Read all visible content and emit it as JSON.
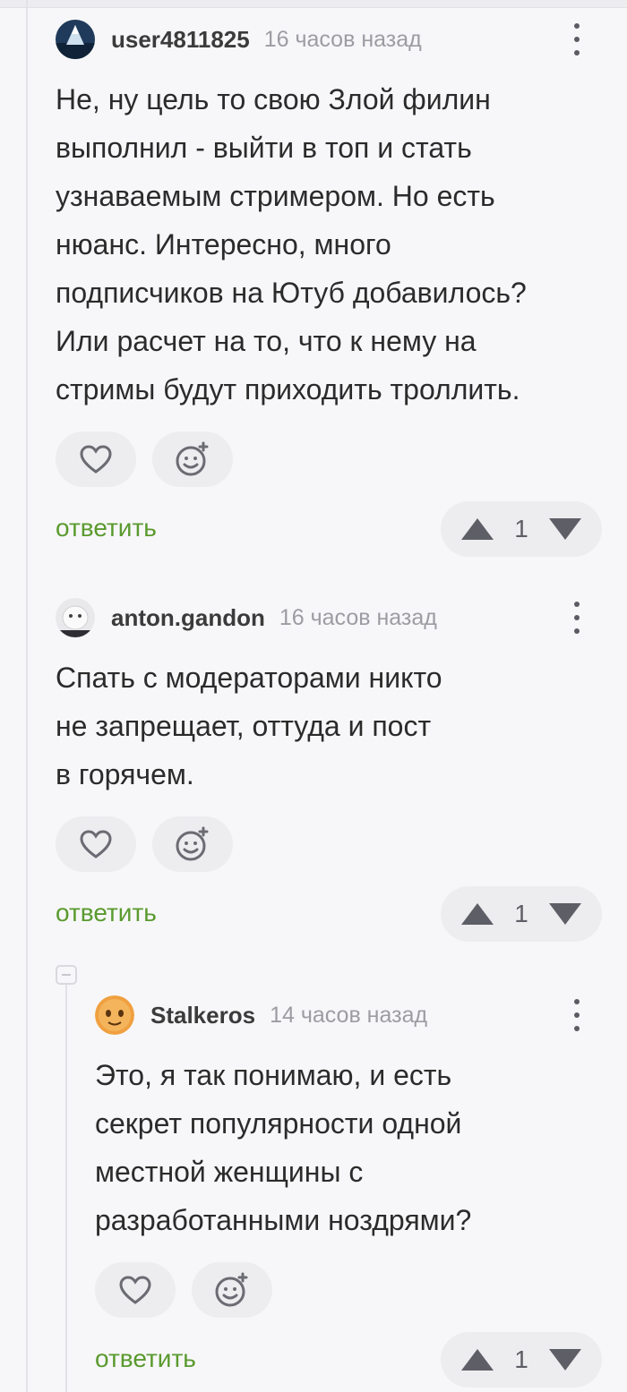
{
  "comments": [
    {
      "username": "user4811825",
      "time": "16 часов назад",
      "text": "Не, ну цель то свою Злой филин\nвыполнил - выйти в топ и стать\nузнаваемым стримером. Но есть\nнюанс. Интересно, много\nподписчиков на Ютуб добавилось?\nИли расчет на то, что к нему на\nстримы будут приходить троллить.",
      "reply_label": "ответить",
      "rating": "1"
    },
    {
      "username": "anton.gandon",
      "time": "16 часов назад",
      "text": "Спать с модераторами никто\nне запрещает, оттуда и пост\nв горячем.",
      "reply_label": "ответить",
      "rating": "1"
    },
    {
      "username": "Stalkeros",
      "time": "14 часов назад",
      "text": "Это, я так понимаю, и есть\nсекрет популярности одной\nместной женщины с\nразработанными ноздрями?",
      "reply_label": "ответить",
      "rating": "1"
    }
  ],
  "icons": {
    "like": "heart-icon",
    "emoji": "add-emoji-icon",
    "upvote": "triangle-up-icon",
    "downvote": "triangle-down-icon",
    "more": "kebab-menu-icon"
  },
  "colors": {
    "reply": "#5a9a2e",
    "muted": "#9c9ca3",
    "button_bg": "#ededf0"
  }
}
